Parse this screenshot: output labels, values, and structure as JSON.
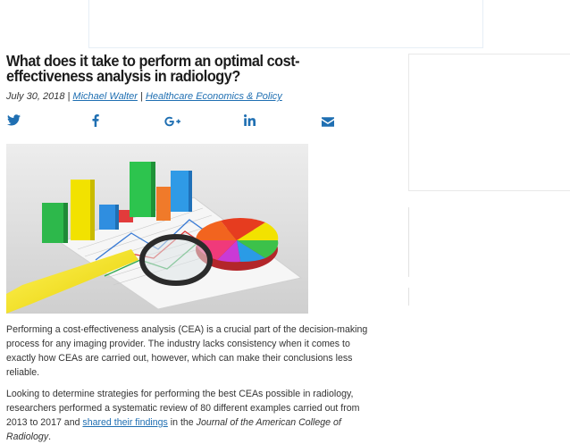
{
  "article": {
    "title": "What does it take to perform an optimal cost-effectiveness analysis in radiology?",
    "date": "July 30, 2018",
    "separator": " | ",
    "author": "Michael Walter",
    "category": "Healthcare Economics & Policy"
  },
  "share": {
    "twitter": "twitter-icon",
    "facebook": "facebook-icon",
    "googleplus": "google-plus-icon",
    "linkedin": "linkedin-icon",
    "email": "email-icon",
    "color": "#1f6fb2"
  },
  "body": {
    "p1": "Performing a cost-effectiveness analysis (CEA) is a crucial part of the decision-making process for any imaging provider. The industry lacks consistency when it comes to exactly how CEAs are carried out, however, which can make their conclusions less reliable.",
    "p2_a": "Looking to determine strategies for performing the best CEAs possible in radiology, researchers performed a systematic review of 80 different examples carried out from 2013 to 2017 and ",
    "p2_link": "shared their findings",
    "p2_b": " in the ",
    "p2_journal": "Journal of the American College of Radiology",
    "p2_end": "."
  }
}
